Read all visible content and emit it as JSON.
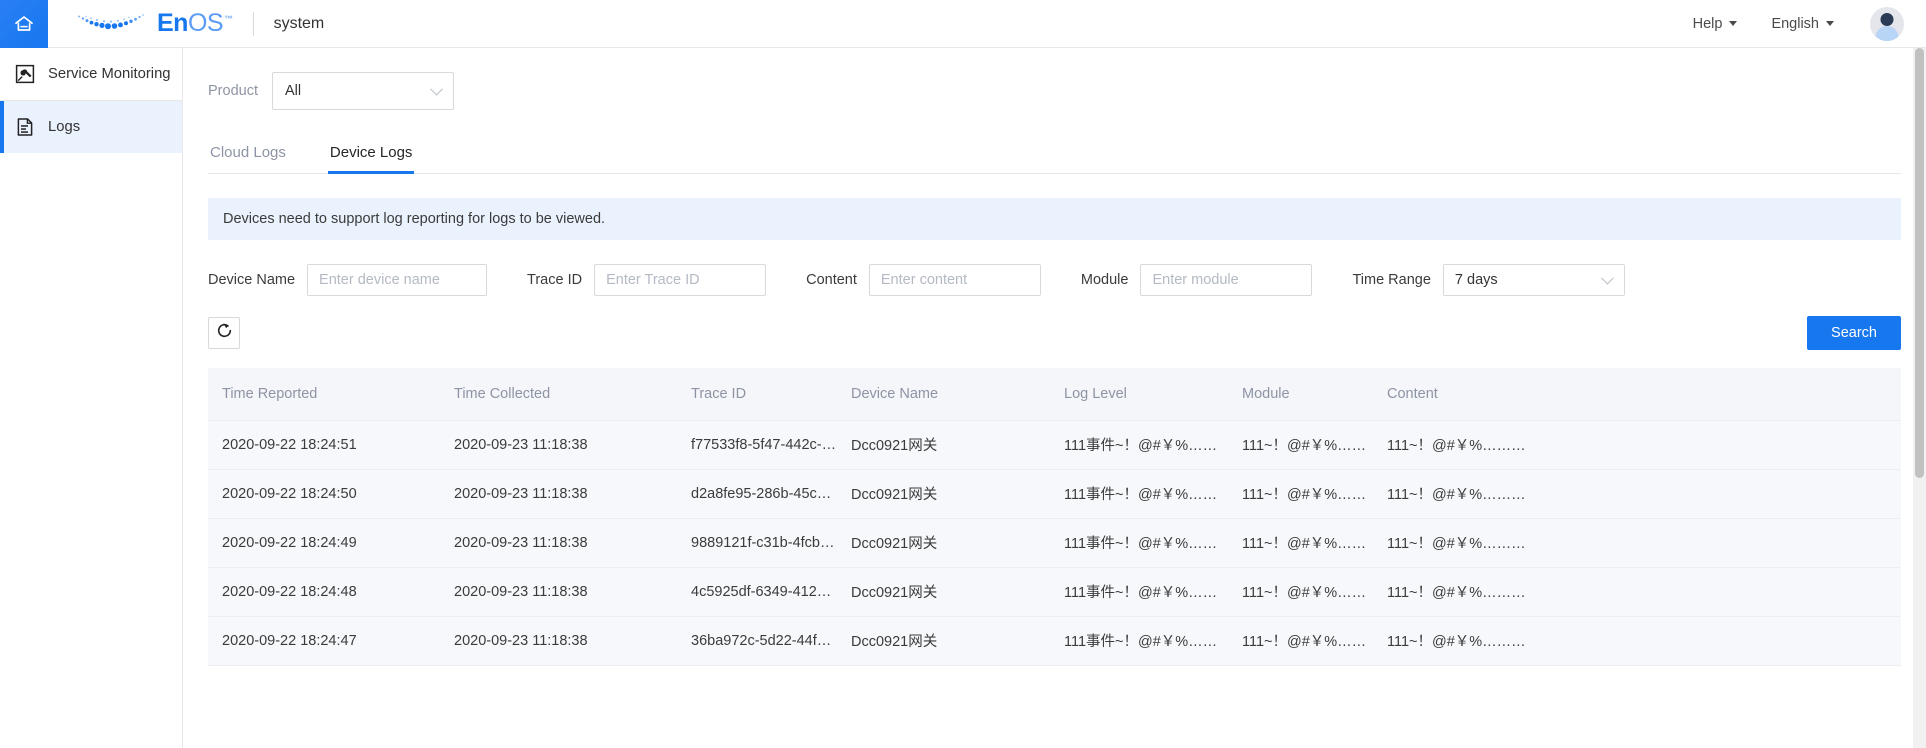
{
  "topbar": {
    "home_icon": "home-icon",
    "brand_en": "En",
    "brand_os": "OS",
    "brand_tm": "™",
    "app_name": "system",
    "help_label": "Help",
    "language_label": "English",
    "avatar": "user-avatar"
  },
  "sidebar": {
    "items": [
      {
        "label": "Service Monitoring",
        "icon": "service-monitoring-icon",
        "active": false
      },
      {
        "label": "Logs",
        "icon": "logs-icon",
        "active": true
      }
    ]
  },
  "product_filter": {
    "label": "Product",
    "value": "All",
    "chevron": "chevron-down-icon"
  },
  "tabs": [
    {
      "label": "Cloud Logs",
      "active": false
    },
    {
      "label": "Device Logs",
      "active": true
    }
  ],
  "banner": {
    "text": "Devices need to support log reporting for logs to be viewed."
  },
  "filters": {
    "device_name": {
      "label": "Device Name",
      "placeholder": "Enter device name",
      "value": ""
    },
    "trace_id": {
      "label": "Trace ID",
      "placeholder": "Enter Trace ID",
      "value": ""
    },
    "content": {
      "label": "Content",
      "placeholder": "Enter content",
      "value": ""
    },
    "module": {
      "label": "Module",
      "placeholder": "Enter module",
      "value": ""
    },
    "time_range": {
      "label": "Time Range",
      "value": "7 days",
      "chevron": "chevron-down-icon"
    }
  },
  "actions": {
    "refresh_icon": "refresh-icon",
    "search_label": "Search"
  },
  "table": {
    "columns": [
      "Time Reported",
      "Time Collected",
      "Trace ID",
      "Device Name",
      "Log Level",
      "Module",
      "Content"
    ],
    "rows": [
      {
        "time_reported": "2020-09-22 18:24:51",
        "time_collected": "2020-09-23 11:18:38",
        "trace_id": "f77533f8-5f47-442c-…",
        "device_name": "Dcc0921网关",
        "log_level": "111事件~！@#￥%……",
        "module": "111~！@#￥%……",
        "content": "111~！@#￥%………"
      },
      {
        "time_reported": "2020-09-22 18:24:50",
        "time_collected": "2020-09-23 11:18:38",
        "trace_id": "d2a8fe95-286b-45c…",
        "device_name": "Dcc0921网关",
        "log_level": "111事件~！@#￥%……",
        "module": "111~！@#￥%……",
        "content": "111~！@#￥%………"
      },
      {
        "time_reported": "2020-09-22 18:24:49",
        "time_collected": "2020-09-23 11:18:38",
        "trace_id": "9889121f-c31b-4fcb…",
        "device_name": "Dcc0921网关",
        "log_level": "111事件~！@#￥%……",
        "module": "111~！@#￥%……",
        "content": "111~！@#￥%………"
      },
      {
        "time_reported": "2020-09-22 18:24:48",
        "time_collected": "2020-09-23 11:18:38",
        "trace_id": "4c5925df-6349-412…",
        "device_name": "Dcc0921网关",
        "log_level": "111事件~！@#￥%……",
        "module": "111~！@#￥%……",
        "content": "111~！@#￥%………"
      },
      {
        "time_reported": "2020-09-22 18:24:47",
        "time_collected": "2020-09-23 11:18:38",
        "trace_id": "36ba972c-5d22-44f…",
        "device_name": "Dcc0921网关",
        "log_level": "111事件~！@#￥%……",
        "module": "111~！@#￥%……",
        "content": "111~！@#￥%………"
      }
    ]
  },
  "colors": {
    "accent": "#1677ef",
    "banner_bg": "#eaf2fd",
    "sidebar_active_bg": "#eaf2fe",
    "table_row_bg": "#f7f8fb",
    "table_head_bg": "#f5f6fa"
  }
}
